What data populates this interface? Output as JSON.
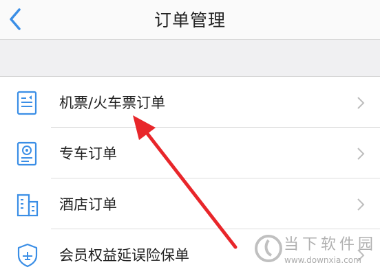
{
  "header": {
    "title": "订单管理",
    "back_icon": "chevron-left-icon",
    "accent_color": "#3a8ee6"
  },
  "menu": {
    "items": [
      {
        "label": "机票/火车票订单",
        "icon": "ticket-document-icon"
      },
      {
        "label": "专车订单",
        "icon": "car-document-icon"
      },
      {
        "label": "酒店订单",
        "icon": "hotel-building-icon"
      },
      {
        "label": "会员权益延误险保单",
        "icon": "shield-plane-icon"
      }
    ],
    "chevron_icon": "chevron-right-icon"
  },
  "annotation": {
    "arrow_color": "#e8262a",
    "arrow_icon": "red-arrow-annotation"
  },
  "watermark": {
    "text": "当下软件园",
    "url": "www.downxia.com"
  }
}
